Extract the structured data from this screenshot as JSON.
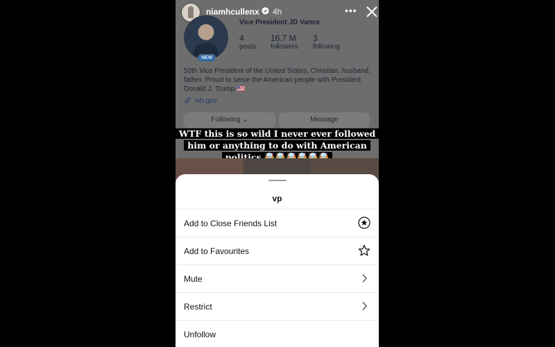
{
  "story": {
    "username": "niamhcullenx",
    "time_ago": "4h",
    "caption": "WTF this is so wild I never ever followed him or anything to do with American politics 🤯🤯🤯🤯🤯🤯"
  },
  "profile": {
    "name": "Vice President JD Vance",
    "badge": "NEW",
    "stats": [
      {
        "num": "4",
        "label": "posts"
      },
      {
        "num": "16.7 M",
        "label": "followers"
      },
      {
        "num": "3",
        "label": "following"
      }
    ],
    "bio": "50th Vice President of the United States. Christian, husband, father. Proud to serve the American people with President Donald J. Trump 🇺🇸",
    "link": "wh.gov",
    "following_label": "Following ⌄",
    "message_label": "Message"
  },
  "sheet": {
    "title": "vp",
    "items": [
      {
        "label": "Add to Close Friends List",
        "icon": "star-circle-icon"
      },
      {
        "label": "Add to Favourites",
        "icon": "star-outline-icon"
      },
      {
        "label": "Mute",
        "icon": "chevron-right-icon"
      },
      {
        "label": "Restrict",
        "icon": "chevron-right-icon"
      },
      {
        "label": "Unfollow",
        "icon": ""
      }
    ]
  }
}
